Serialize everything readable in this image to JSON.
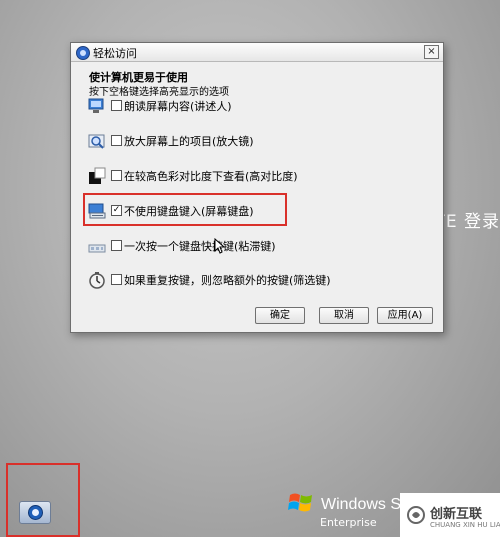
{
  "background_text": "TE 登录",
  "dialog": {
    "title": "轻松访问",
    "close_glyph": "×",
    "heading": "使计算机更易于使用",
    "subheading": "按下空格键选择高亮显示的选项",
    "options": [
      {
        "label": "朗读屏幕内容(讲述人)",
        "checked": false,
        "icon": "narrator-icon"
      },
      {
        "label": "放大屏幕上的项目(放大镜)",
        "checked": false,
        "icon": "magnifier-icon"
      },
      {
        "label": "在较高色彩对比度下查看(高对比度)",
        "checked": false,
        "icon": "high-contrast-icon"
      },
      {
        "label": "不使用键盘键入(屏幕键盘)",
        "checked": true,
        "icon": "on-screen-keyboard-icon"
      },
      {
        "label": "一次按一个键盘快捷键(粘滞键)",
        "checked": false,
        "icon": "sticky-keys-icon"
      },
      {
        "label": "如果重复按键，则忽略额外的按键(筛选键)",
        "checked": false,
        "icon": "filter-keys-icon"
      }
    ],
    "buttons": {
      "ok": "确定",
      "cancel": "取消",
      "apply": "应用(A)"
    }
  },
  "windows_brand": {
    "name": "Windows Se",
    "edition": "Enterprise"
  },
  "watermark": {
    "text": "创新互联",
    "sub": "CHUANG XIN HU LIAN"
  },
  "colors": {
    "highlight": "#d9302a",
    "accent": "#2e67c8"
  }
}
